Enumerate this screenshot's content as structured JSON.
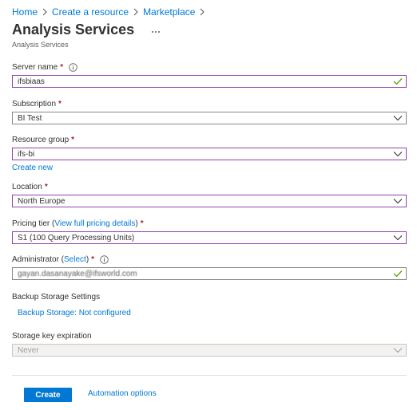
{
  "breadcrumb": {
    "items": [
      "Home",
      "Create a resource",
      "Marketplace"
    ]
  },
  "header": {
    "title": "Analysis Services",
    "subtitle": "Analysis Services",
    "more_label": "..."
  },
  "form": {
    "server_name": {
      "label": "Server name",
      "required_mark": "*",
      "value": "ifsbiaas"
    },
    "subscription": {
      "label": "Subscription",
      "required_mark": "*",
      "value": "BI Test"
    },
    "resource_group": {
      "label": "Resource group",
      "required_mark": "*",
      "value": "ifs-bi",
      "create_new_label": "Create new"
    },
    "location": {
      "label": "Location",
      "required_mark": "*",
      "value": "North Europe"
    },
    "pricing_tier": {
      "label_prefix": "Pricing tier (",
      "label_link": "View full pricing details",
      "label_suffix": ")",
      "required_mark": "*",
      "value": "S1 (100 Query Processing Units)"
    },
    "administrator": {
      "label_prefix": "Administrator (",
      "label_link": "Select",
      "label_suffix": ")",
      "required_mark": "*",
      "value": "gayan.dasanayake@ifsworld.com"
    },
    "backup_storage": {
      "section_label": "Backup Storage Settings",
      "link_label": "Backup Storage: Not configured"
    },
    "storage_key_expiration": {
      "label": "Storage key expiration",
      "value": "Never"
    }
  },
  "footer": {
    "create_label": "Create",
    "automation_label": "Automation options"
  },
  "colors": {
    "accent": "#0078d4",
    "focus_border": "#8e44ad",
    "valid_check": "#57a300",
    "required": "#a4262c"
  },
  "icons": {
    "breadcrumb_separator": "chevron-right-icon",
    "more": "more-icon",
    "info": "info-icon",
    "valid": "checkmark-icon",
    "dropdown": "chevron-down-icon"
  }
}
